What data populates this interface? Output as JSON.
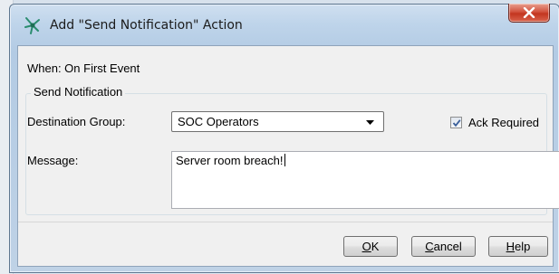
{
  "window": {
    "title": "Add \"Send Notification\" Action",
    "close_label": "X"
  },
  "trigger": {
    "text": "When: On First Event"
  },
  "group": {
    "label": "Send Notification"
  },
  "destination": {
    "label": "Destination Group:",
    "selected": "SOC Operators"
  },
  "ack": {
    "label": "Ack Required",
    "checked": true
  },
  "message": {
    "label": "Message:",
    "value": "Server room breach!"
  },
  "buttons": {
    "ok": {
      "mnemonic": "O",
      "rest": "K"
    },
    "cancel": {
      "mnemonic": "C",
      "rest": "ancel"
    },
    "help": {
      "mnemonic": "H",
      "rest": "elp"
    }
  },
  "colors": {
    "window_frame": "#bed4ea",
    "dialog_background": "#f0f0f0",
    "close_button": "#c3351f",
    "icon_accent": "#2a8c6e"
  },
  "icons": {
    "app": "network-node-icon",
    "close": "close-icon",
    "dropdown": "chevron-down-icon",
    "check": "checkmark-icon"
  }
}
